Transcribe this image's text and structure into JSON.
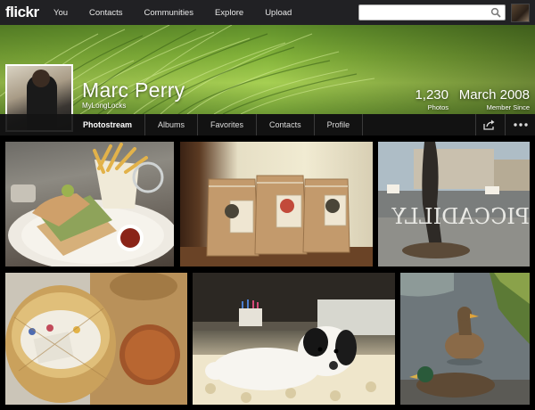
{
  "header": {
    "logo": "flickr",
    "nav": [
      "You",
      "Contacts",
      "Communities",
      "Explore",
      "Upload"
    ],
    "search_placeholder": ""
  },
  "profile": {
    "name": "Marc Perry",
    "username": "MyLongLocks",
    "stats": [
      {
        "value": "1,230",
        "label": "Photos"
      },
      {
        "value": "March 2008",
        "label": "Member Since"
      }
    ]
  },
  "subnav": {
    "tabs": [
      "Photostream",
      "Albums",
      "Favorites",
      "Contacts",
      "Profile"
    ],
    "share_icon": "share-icon",
    "more_icon": "more-icon"
  },
  "photos": [
    {
      "subject": "sandwich-and-fries"
    },
    {
      "subject": "coffee-bags"
    },
    {
      "subject": "street-window"
    },
    {
      "subject": "basket-and-bread"
    },
    {
      "subject": "puppy"
    },
    {
      "subject": "ducks"
    }
  ],
  "colors": {
    "topbar": "#212124",
    "cover_green": "#83b33a"
  }
}
